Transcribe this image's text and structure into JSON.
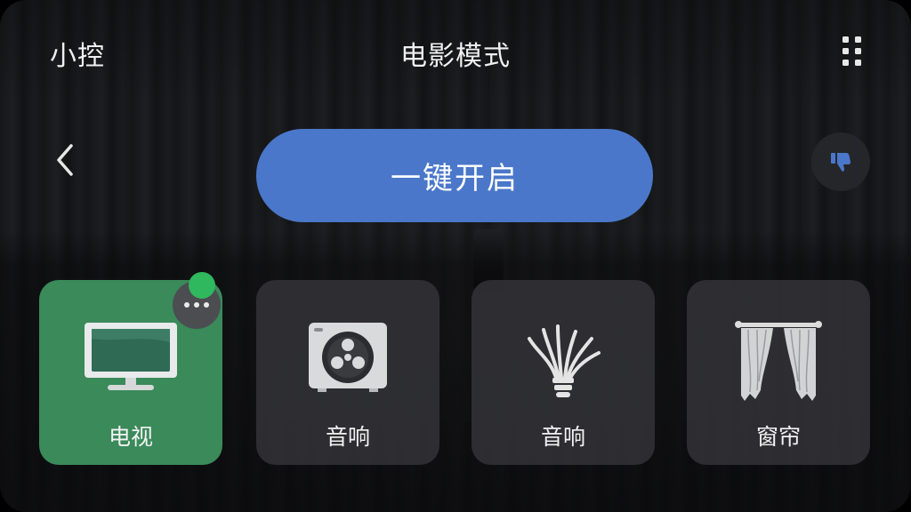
{
  "header": {
    "app_name": "小控",
    "title": "电影模式",
    "menu_icon": "grid-dots-icon"
  },
  "controls": {
    "back_icon": "chevron-left-icon",
    "one_click_label": "一键开启",
    "dislike_icon": "thumbs-down-icon"
  },
  "devices": [
    {
      "label": "电视",
      "icon": "tv-icon",
      "active": true
    },
    {
      "label": "音响",
      "icon": "speaker-icon",
      "active": false
    },
    {
      "label": "音响",
      "icon": "light-bulb-icon",
      "active": false
    },
    {
      "label": "窗帘",
      "icon": "curtain-icon",
      "active": false
    }
  ],
  "colors": {
    "accent_blue": "#4a77c9",
    "active_green": "#3a8a5a",
    "status_green": "#2fb85e"
  }
}
